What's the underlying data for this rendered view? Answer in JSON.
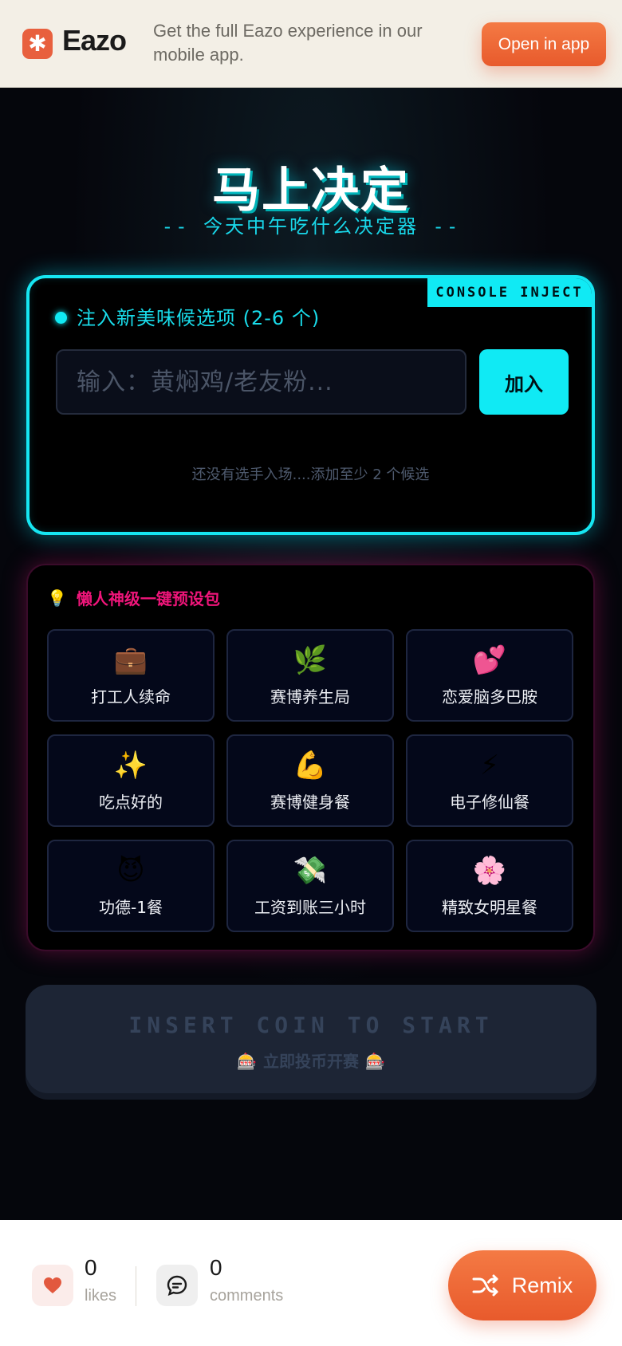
{
  "banner": {
    "logo_name": "Eazo",
    "promo_text": "Get the full Eazo experience in our mobile app.",
    "open_label": "Open in app",
    "brand_color": "#e8603e"
  },
  "app": {
    "title": "马上决定",
    "subtitle": "-- 今天中午吃什么决定器 --",
    "accent_cyan": "#10eaf4",
    "accent_pink": "#f0157a"
  },
  "inject": {
    "tag": "CONSOLE INJECT",
    "label": "注入新美味候选项 (2-6 个)",
    "placeholder": "输入：黄焖鸡/老友粉...",
    "value": "",
    "add_label": "加入",
    "empty_hint": "还没有选手入场....添加至少 2 个候选"
  },
  "presets": {
    "icon": "lightbulb-icon",
    "title": "懒人神级一键预设包",
    "items": [
      {
        "emoji": "💼",
        "icon": "briefcase-icon",
        "label": "打工人续命"
      },
      {
        "emoji": "🌿",
        "icon": "herb-icon",
        "label": "赛博养生局"
      },
      {
        "emoji": "💕",
        "icon": "two-hearts-icon",
        "label": "恋爱脑多巴胺"
      },
      {
        "emoji": "✨",
        "icon": "sparkles-icon",
        "label": "吃点好的"
      },
      {
        "emoji": "💪",
        "icon": "flexed-biceps-icon",
        "label": "赛博健身餐"
      },
      {
        "emoji": "⚡",
        "icon": "lightning-icon",
        "label": "电子修仙餐"
      },
      {
        "emoji": "😈",
        "icon": "devil-face-icon",
        "label": "功德-1餐"
      },
      {
        "emoji": "💸",
        "icon": "money-wings-icon",
        "label": "工资到账三小时"
      },
      {
        "emoji": "🌸",
        "icon": "cherry-blossom-icon",
        "label": "精致女明星餐"
      }
    ]
  },
  "start": {
    "main_label": "INSERT COIN TO START",
    "sub_label": "立即投币开赛",
    "slot_emoji": "🎰"
  },
  "footer": {
    "likes_count": "0",
    "likes_label": "likes",
    "comments_count": "0",
    "comments_label": "comments",
    "remix_label": "Remix"
  }
}
